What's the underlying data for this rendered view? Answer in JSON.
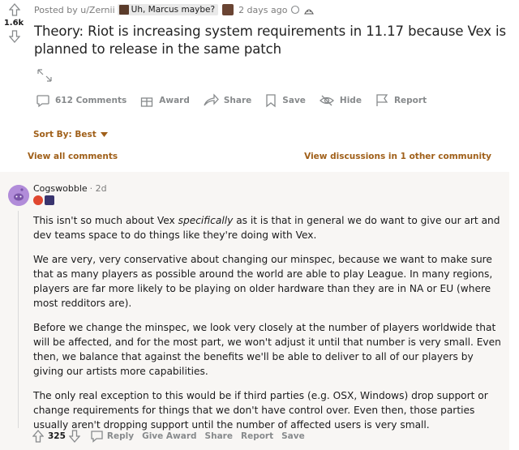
{
  "post": {
    "score": "1.6k",
    "posted_by": "Posted by u/Zernii",
    "flair": "Uh, Marcus maybe?",
    "time": "2 days ago",
    "title": "Theory: Riot is increasing system requirements in 11.17 because Vex is planned to release in the same patch",
    "actions": {
      "comments": "612 Comments",
      "award": "Award",
      "share": "Share",
      "save": "Save",
      "hide": "Hide",
      "report": "Report"
    }
  },
  "sort": {
    "label": "Sort By: Best"
  },
  "links": {
    "view_all": "View all comments",
    "view_other": "View discussions in 1 other community"
  },
  "comment": {
    "author": "Cogswobble",
    "time": "· 2d",
    "paragraphs": {
      "p1_before": "This isn't so much about Vex ",
      "p1_em": "specifically",
      "p1_after": " as it is that in general we do want to give our art and dev teams space to do things like they're doing with Vex.",
      "p2": "We are very, very conservative about changing our minspec, because we want to make sure that as many players as possible around the world are able to play League. In many regions, players are far more likely to be playing on older hardware than they are in NA or EU (where most redditors are).",
      "p3": "Before we change the minspec, we look very closely at the number of players worldwide that will be affected, and for the most part, we won't adjust it until that number is very small. Even then, we balance that against the benefits we'll be able to deliver to all of our players by giving our artists more capabilities.",
      "p4": "The only real exception to this would be if third parties (e.g. OSX, Windows) drop support or change requirements for things that we don't have control over. Even then, those parties usually aren't dropping support until the number of affected users is very small."
    },
    "score": "325",
    "actions": {
      "reply": "Reply",
      "give_award": "Give Award",
      "share": "Share",
      "report": "Report",
      "save": "Save"
    }
  },
  "colors": {
    "link": "#a0601a",
    "muted": "#878a8c",
    "comment_bg": "#f8f6f4",
    "avatar": "#b18cd9"
  }
}
